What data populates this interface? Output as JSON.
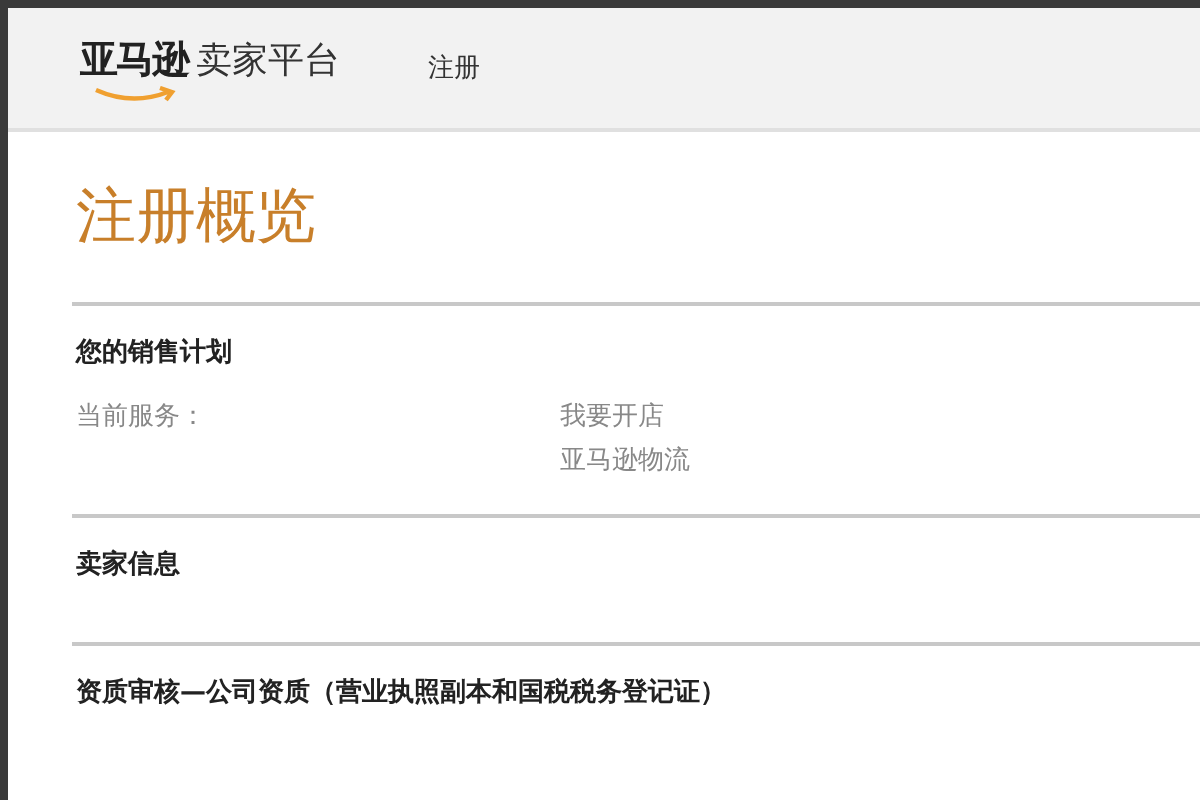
{
  "header": {
    "logo_mark": "亚马逊",
    "logo_text": "卖家平台",
    "nav": [
      {
        "label": "注册",
        "selected": false
      }
    ]
  },
  "title": "注册概览",
  "sections": [
    {
      "heading": "您的销售计划",
      "rows": [
        {
          "label": "当前服务：",
          "values": [
            "我要开店",
            "亚马逊物流"
          ]
        }
      ]
    },
    {
      "heading": "卖家信息"
    },
    {
      "heading": "资质审核—公司资质（营业执照副本和国税税务登记证）"
    }
  ]
}
